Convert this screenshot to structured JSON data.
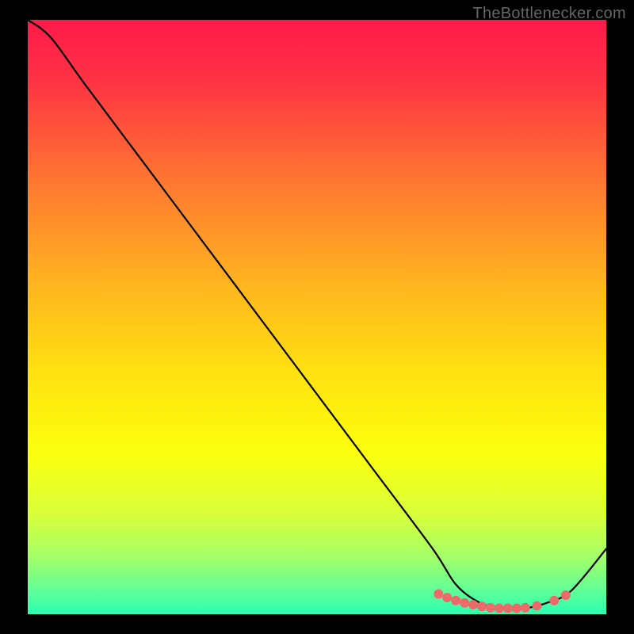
{
  "watermark": "TheBottlenecker.com",
  "chart_data": {
    "type": "line",
    "title": "",
    "xlabel": "",
    "ylabel": "",
    "xlim": [
      0,
      100
    ],
    "ylim": [
      0,
      100
    ],
    "grid": false,
    "background_gradient": {
      "stops": [
        {
          "pct": 0,
          "color": "#ff1a49"
        },
        {
          "pct": 10,
          "color": "#ff3244"
        },
        {
          "pct": 28,
          "color": "#ff7a30"
        },
        {
          "pct": 45,
          "color": "#ffb61f"
        },
        {
          "pct": 60,
          "color": "#ffe310"
        },
        {
          "pct": 73,
          "color": "#fcff0d"
        },
        {
          "pct": 83,
          "color": "#d9ff3a"
        },
        {
          "pct": 90,
          "color": "#a7ff66"
        },
        {
          "pct": 95,
          "color": "#6cff8e"
        },
        {
          "pct": 100,
          "color": "#2dffb2"
        }
      ]
    },
    "series": [
      {
        "name": "curve",
        "style": "black-line",
        "x": [
          0,
          4,
          10,
          20,
          30,
          40,
          50,
          60,
          70,
          74,
          78,
          82,
          86,
          90,
          94,
          100
        ],
        "values": [
          100,
          97,
          89,
          76,
          63,
          50,
          37,
          24,
          11,
          5,
          2,
          1,
          1,
          2,
          4,
          11
        ]
      },
      {
        "name": "highlight-dots",
        "style": "salmon-dots",
        "x": [
          71.0,
          72.5,
          74.0,
          75.5,
          77.0,
          78.5,
          80.0,
          81.5,
          83.0,
          84.5,
          86.0,
          88.0,
          91.0,
          93.0
        ],
        "values": [
          3.4,
          2.8,
          2.3,
          1.9,
          1.6,
          1.3,
          1.1,
          1.0,
          1.0,
          1.0,
          1.1,
          1.4,
          2.3,
          3.2
        ]
      }
    ]
  }
}
